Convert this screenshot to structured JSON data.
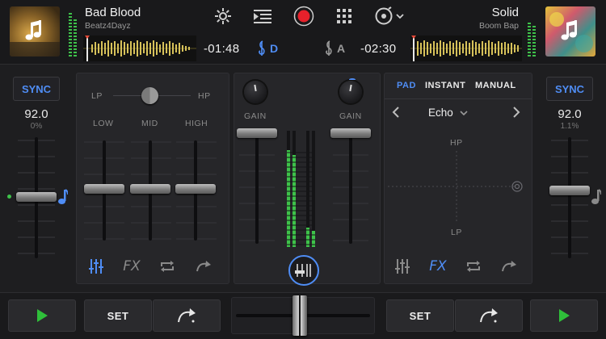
{
  "deck_a": {
    "title": "Bad Blood",
    "artist": "Beatz4Dayz",
    "time": "-01:48",
    "key": "D",
    "bpm": "92.0",
    "pitch": "0%",
    "sync_label": "SYNC",
    "key_color": "#4f8df5"
  },
  "deck_b": {
    "title": "Solid",
    "artist": "Boom Bap",
    "time": "-02:30",
    "key": "A",
    "bpm": "92.0",
    "pitch": "1.1%",
    "sync_label": "SYNC",
    "key_color": "#9a9a9a"
  },
  "toolbar": {
    "icons": [
      "gear-icon",
      "playlist-icon",
      "record-icon",
      "grid-icon",
      "vinyl-menu-icon"
    ],
    "record_color": "#e8212b"
  },
  "eq": {
    "lp_label": "LP",
    "hp_label": "HP",
    "bands": [
      "LOW",
      "MID",
      "HIGH"
    ]
  },
  "mixer": {
    "gain_label_a": "GAIN",
    "gain_label_b": "GAIN"
  },
  "fx": {
    "tabs": [
      "PAD",
      "INSTANT",
      "MANUAL"
    ],
    "active_tab": "PAD",
    "effect_name": "Echo",
    "pad_top_label": "HP",
    "pad_bottom_label": "LP"
  },
  "bottom": {
    "set_label_a": "SET",
    "set_label_b": "SET"
  },
  "colors": {
    "accent": "#4f8df5",
    "play_green": "#2fbf3a",
    "meter_green": "#3ec24a"
  }
}
